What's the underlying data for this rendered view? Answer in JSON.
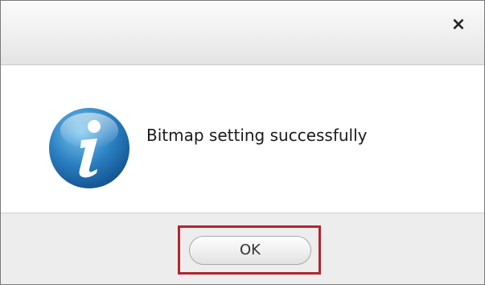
{
  "dialog": {
    "close_glyph": "×",
    "close_icon": "close-icon",
    "message": "Bitmap setting successfully",
    "icon": "info-icon",
    "ok_label": "OK"
  },
  "colors": {
    "highlight_border": "#b3252d",
    "icon_blue": "#2a7fc1",
    "footer_bg": "#ededed"
  }
}
